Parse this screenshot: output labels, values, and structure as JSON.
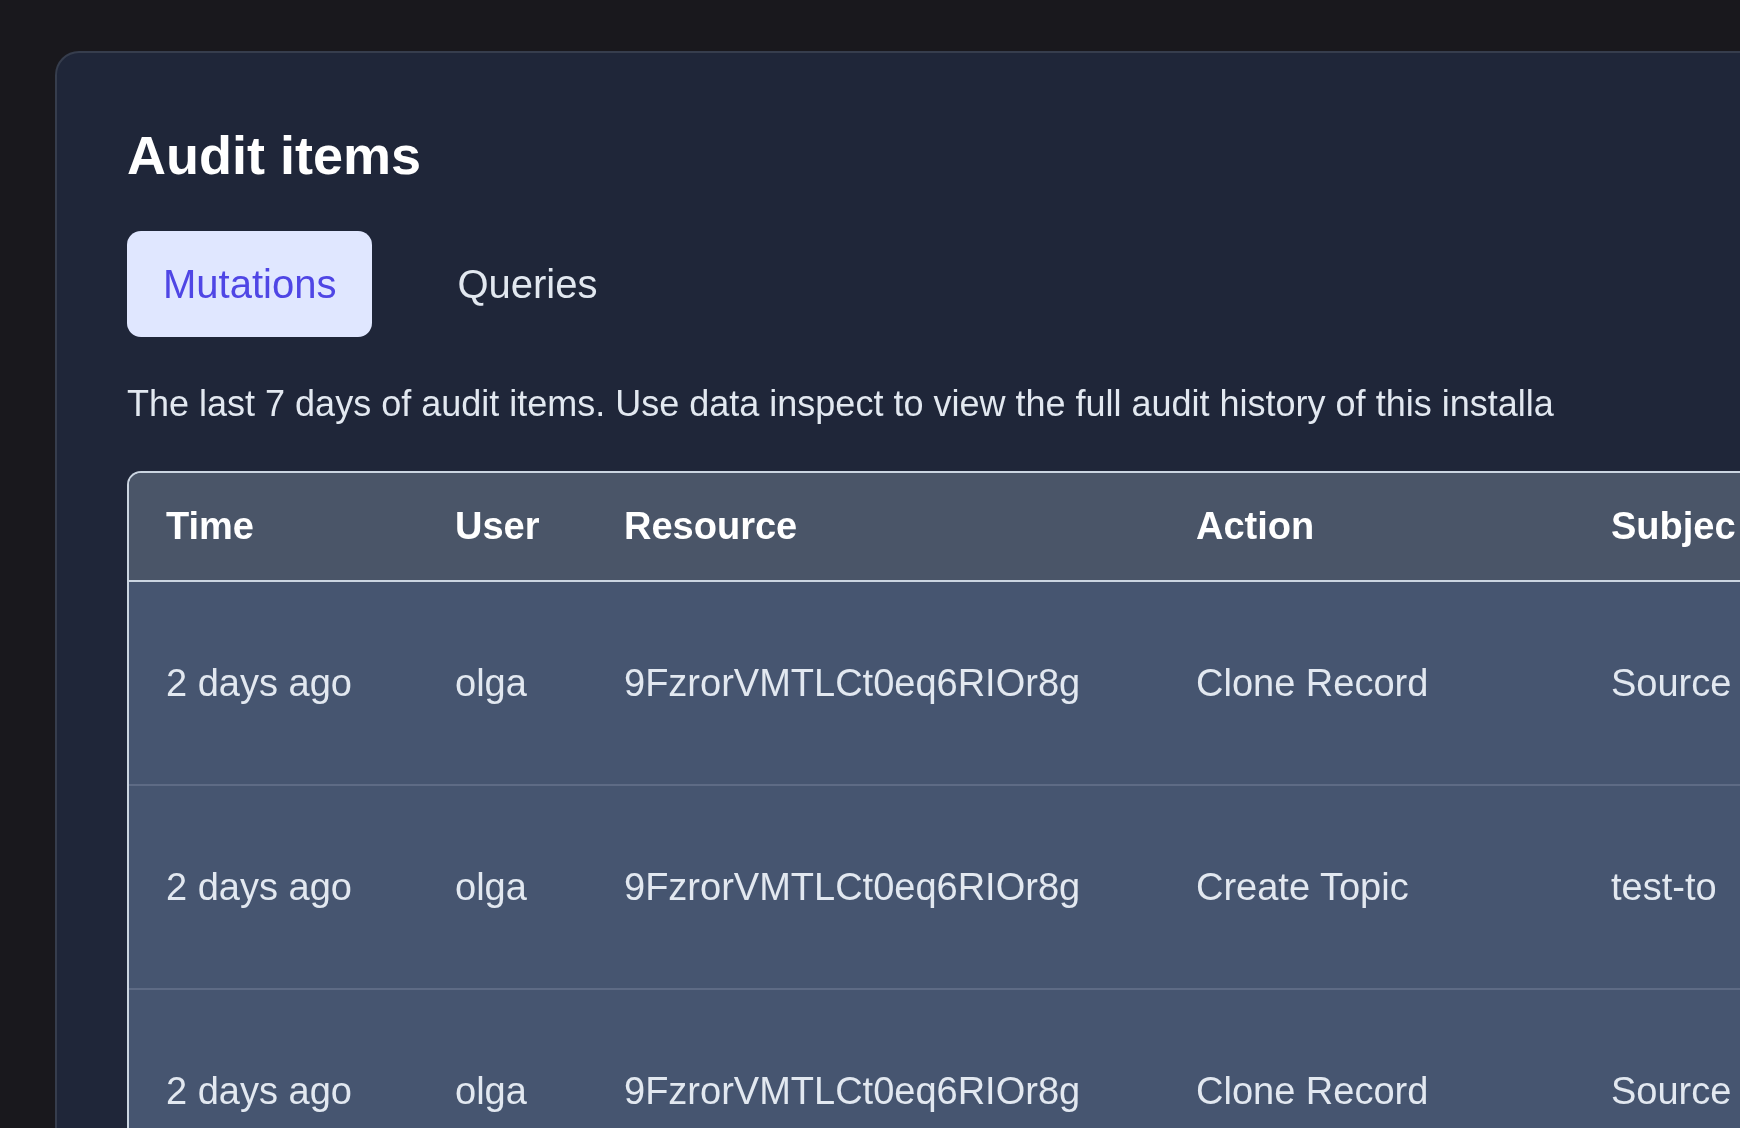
{
  "title": "Audit items",
  "tabs": [
    {
      "label": "Mutations",
      "selected": true
    },
    {
      "label": "Queries",
      "selected": false
    }
  ],
  "description": "The last 7 days of audit items. Use data inspect to view the full audit history of this installa",
  "table": {
    "columns": [
      "Time",
      "User",
      "Resource",
      "Action",
      "Subjec"
    ],
    "rows": [
      [
        "2 days ago",
        "olga",
        "9FzrorVMTLCt0eq6RIOr8g",
        "Clone Record",
        "Source"
      ],
      [
        "2 days ago",
        "olga",
        "9FzrorVMTLCt0eq6RIOr8g",
        "Create Topic",
        "test-to"
      ],
      [
        "2 days ago",
        "olga",
        "9FzrorVMTLCt0eq6RIOr8g",
        "Clone Record",
        "Source"
      ]
    ]
  }
}
